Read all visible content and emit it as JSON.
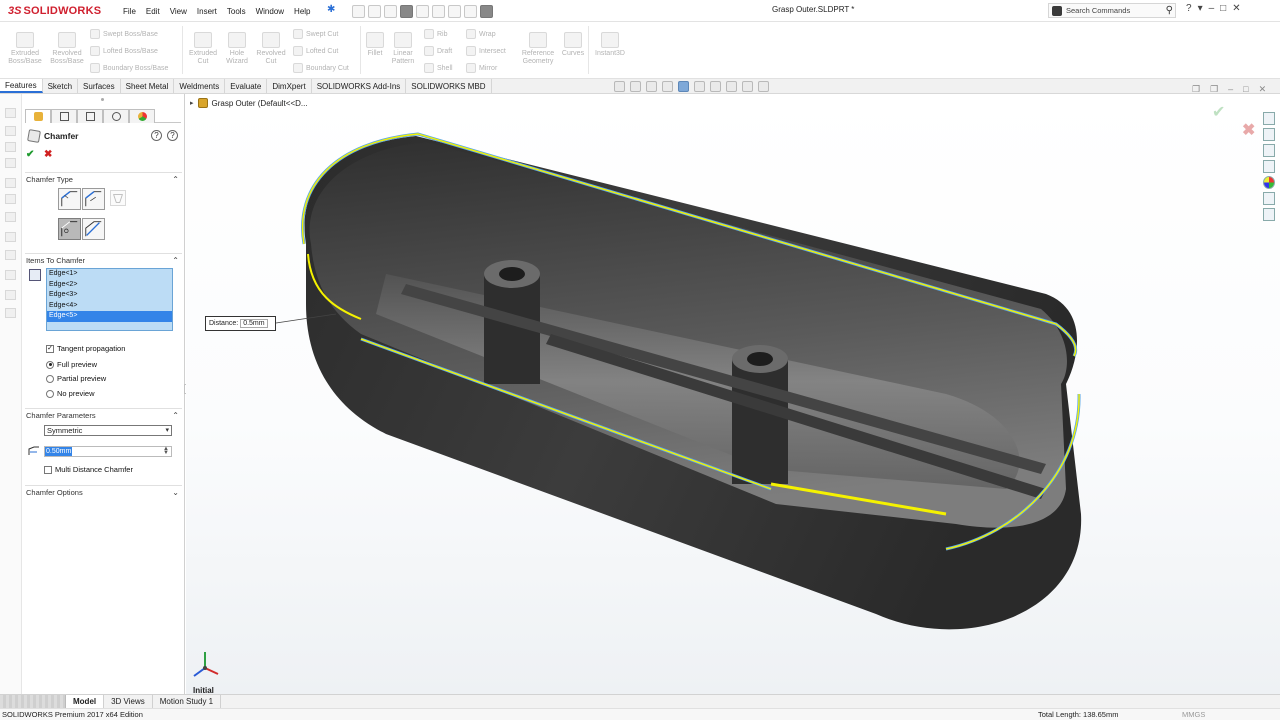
{
  "app": {
    "logo_text": "SOLIDWORKS",
    "logo_ds": "3S",
    "document_title": "Grasp Outer.SLDPRT *",
    "menu": [
      "File",
      "Edit",
      "View",
      "Insert",
      "Tools",
      "Window",
      "Help"
    ],
    "search_placeholder": "Search Commands",
    "window_controls": [
      "?",
      "▾",
      "–",
      "□",
      "✕"
    ]
  },
  "command_manager": {
    "extruded_boss": "Extruded\nBoss/Base",
    "revolved_boss": "Revolved\nBoss/Base",
    "swept_boss": "Swept Boss/Base",
    "lofted_boss": "Lofted Boss/Base",
    "boundary_boss": "Boundary Boss/Base",
    "extruded_cut": "Extruded\nCut",
    "hole_wizard": "Hole\nWizard",
    "revolved_cut": "Revolved\nCut",
    "swept_cut": "Swept Cut",
    "lofted_cut": "Lofted Cut",
    "boundary_cut": "Boundary Cut",
    "fillet": "Fillet",
    "linear_pattern": "Linear\nPattern",
    "rib": "Rib",
    "draft": "Draft",
    "shell": "Shell",
    "wrap": "Wrap",
    "intersect": "Intersect",
    "mirror": "Mirror",
    "reference_geometry": "Reference\nGeometry",
    "curves": "Curves",
    "instant3d": "Instant3D"
  },
  "tabs": [
    "Features",
    "Sketch",
    "Surfaces",
    "Sheet Metal",
    "Weldments",
    "Evaluate",
    "DimXpert",
    "SOLIDWORKS Add-Ins",
    "SOLIDWORKS MBD"
  ],
  "active_tab": "Features",
  "tree": {
    "part_label": "Grasp Outer  (Default<<D..."
  },
  "property_manager": {
    "title": "Chamfer",
    "ok": "✔",
    "cancel": "✖",
    "chamfer_type_label": "Chamfer Type",
    "items_label": "Items To Chamfer",
    "edges": [
      "Edge<1>",
      "Edge<2>",
      "Edge<3>",
      "Edge<4>",
      "Edge<5>"
    ],
    "selected_edge": "Edge<5>",
    "tangent_propagation": "Tangent propagation",
    "tangent_checked": true,
    "full_preview": "Full preview",
    "partial_preview": "Partial preview",
    "no_preview": "No preview",
    "preview_mode": "Full preview",
    "params_label": "Chamfer Parameters",
    "type_value": "Symmetric",
    "distance_value": "0.50mm",
    "multi_distance": "Multi Distance Chamfer",
    "multi_distance_checked": false,
    "options_label": "Chamfer Options"
  },
  "graphics": {
    "callout_label": "Distance:",
    "callout_value": "0.5mm",
    "triad_label": "Initial",
    "colors": {
      "model": "#3a3a3a",
      "edge_highlight": "#f5f200",
      "edge_selected": "#5aa6e6"
    }
  },
  "bottom_tabs": [
    "Model",
    "3D Views",
    "Motion Study 1"
  ],
  "active_bottom_tab": "Model",
  "status": {
    "edition": "SOLIDWORKS Premium 2017 x64 Edition",
    "total_length": "Total Length: 138.65mm",
    "units": "MMGS"
  }
}
